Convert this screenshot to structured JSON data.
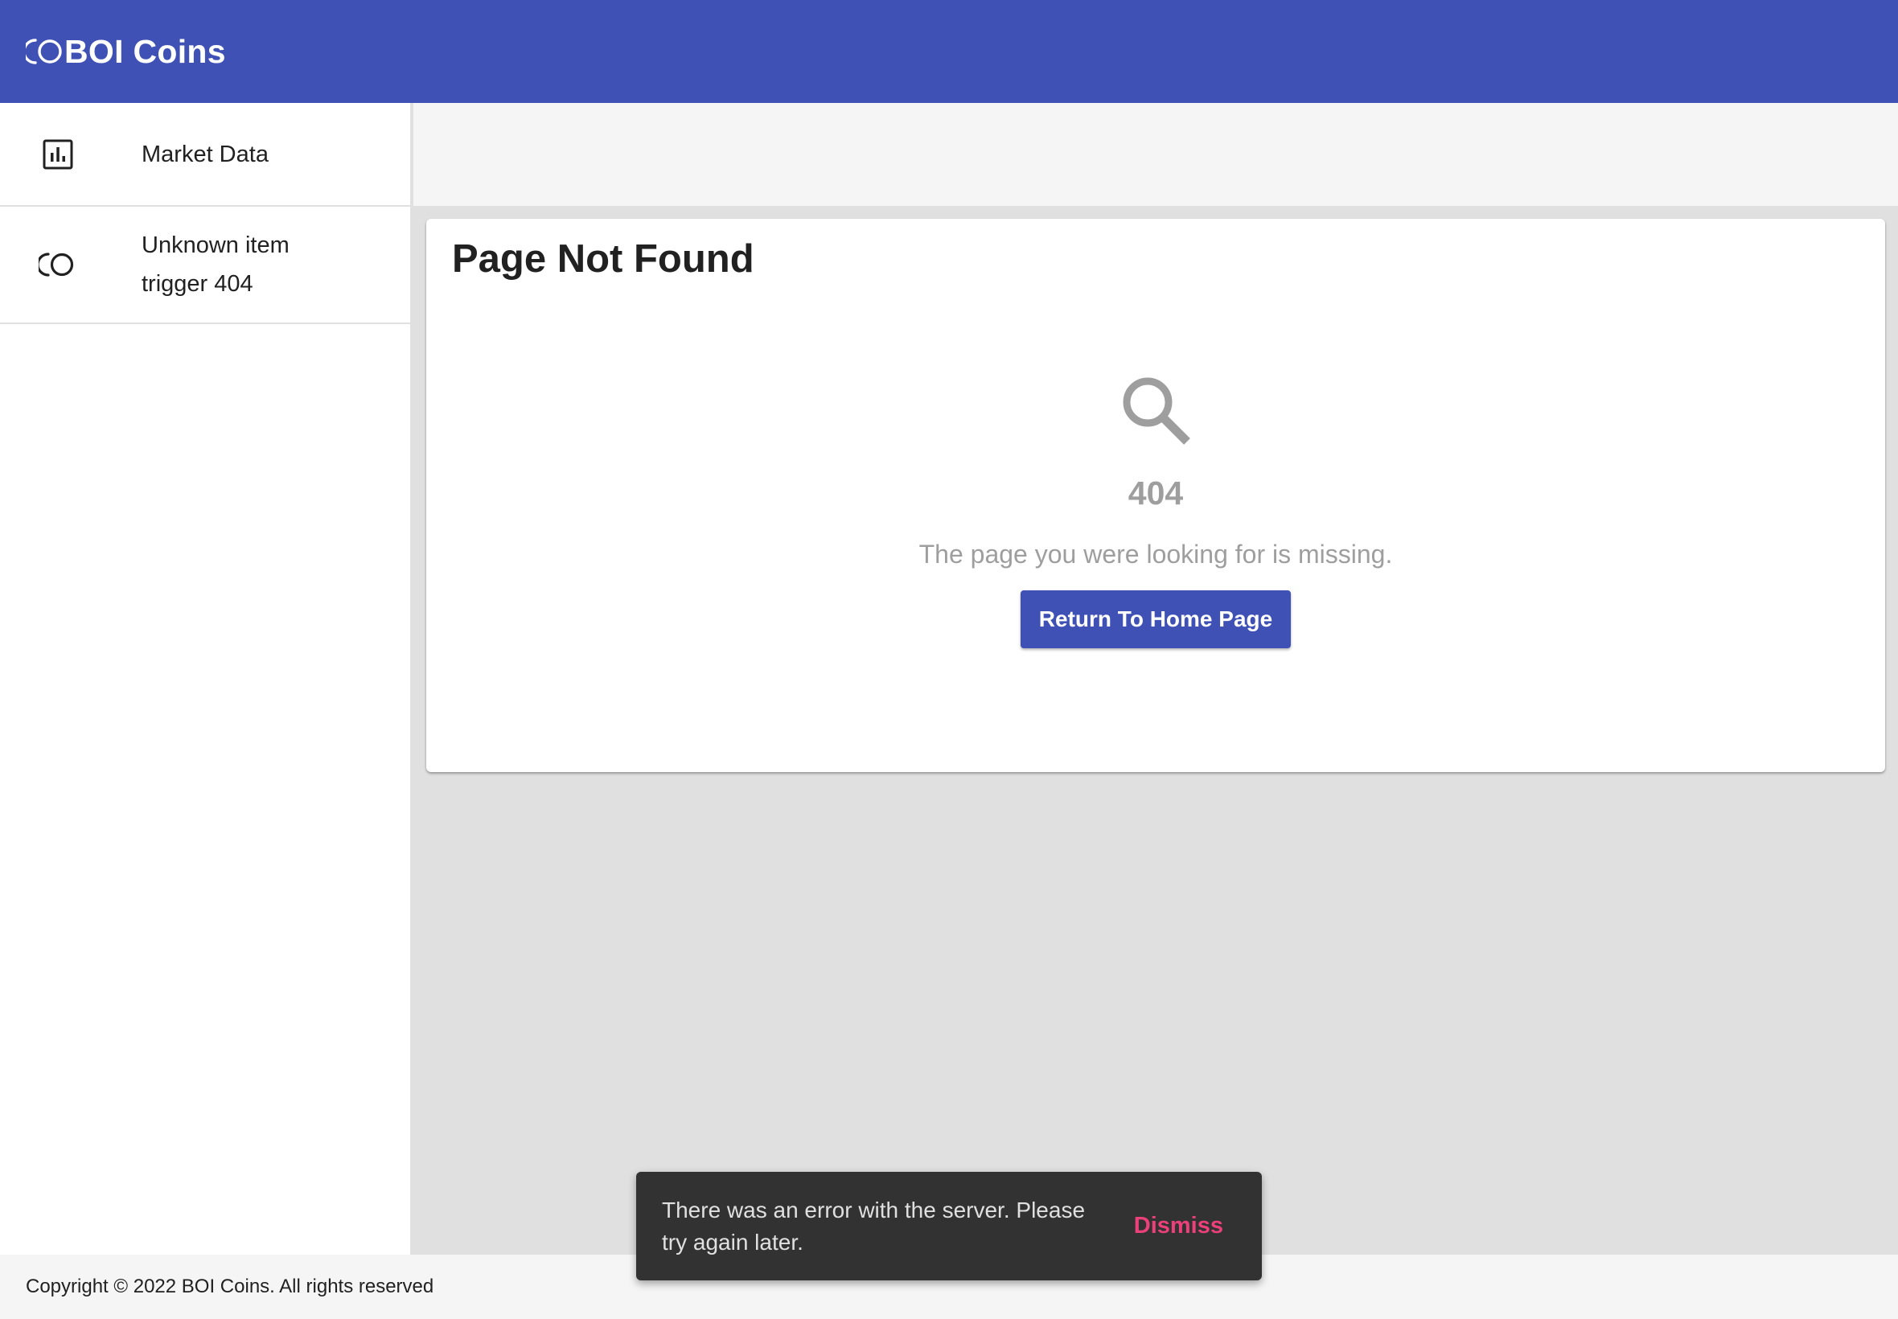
{
  "header": {
    "brand_title": "BOI Coins",
    "brand_icon": "coins-icon",
    "background_color": "#3f51b5"
  },
  "sidebar": {
    "items": [
      {
        "label": "Market Data",
        "icon": "bar-chart-icon"
      },
      {
        "label": "Unknown item trigger 404",
        "icon": "coins-icon"
      }
    ]
  },
  "main": {
    "card": {
      "title": "Page Not Found",
      "icon": "search-icon",
      "error_code": "404",
      "message": "The page you were looking for is missing.",
      "button_label": "Return To Home Page"
    }
  },
  "footer": {
    "copyright": "Copyright © 2022 BOI Coins. All rights reserved"
  },
  "snackbar": {
    "message": "There was an error with the server. Please try again later.",
    "action_label": "Dismiss",
    "action_color": "#ec407a"
  }
}
